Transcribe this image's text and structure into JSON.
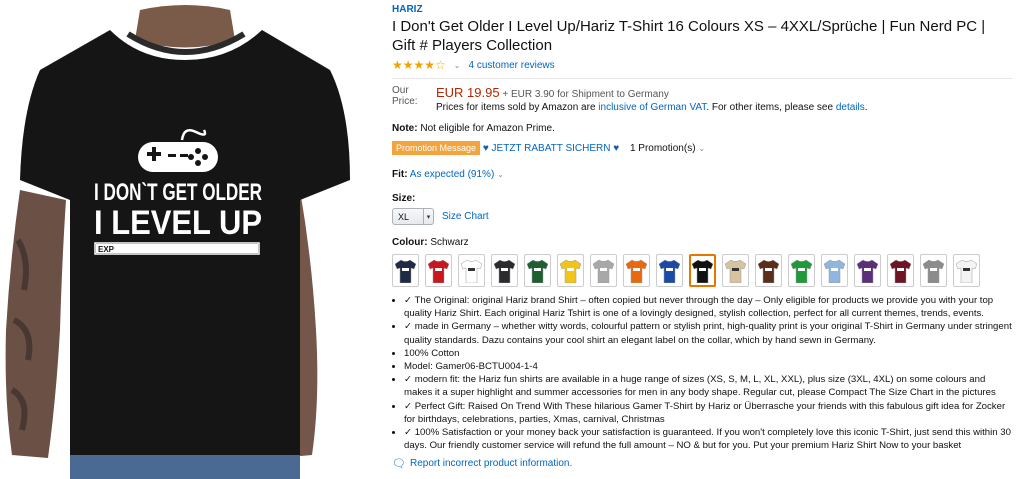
{
  "product_image": {
    "graphic_line1": "I DON`T GET OLDER",
    "graphic_line2": "I LEVEL UP",
    "xp_label": "EXP",
    "xp_progress": 1.0
  },
  "brand": "HARIZ",
  "title": "I Don't Get Older I Level Up/Hariz T-Shirt 16 Colours XS – 4XXL/Sprüche | Fun Nerd PC | Gift # Players Collection",
  "rating": {
    "stars": "★★★★☆",
    "value": 4.5,
    "reviews_label": "4 customer reviews"
  },
  "price": {
    "label": "Our Price:",
    "amount": "EUR 19.95",
    "shipping": "+ EUR 3.90 for Shipment to Germany",
    "vat_pre": "Prices for items sold by Amazon are",
    "vat_link": "inclusive of German VAT",
    "vat_mid": ". For other items, please see",
    "details_link": "details",
    "vat_end": "."
  },
  "note": {
    "label": "Note:",
    "text": "Not eligible for Amazon Prime."
  },
  "promotion": {
    "badge": "Promotion Message",
    "text": "JETZT RABATT SICHERN",
    "count": "1 Promotion(s)"
  },
  "fit": {
    "label": "Fit:",
    "value": "As expected (91%)"
  },
  "size": {
    "label": "Size:",
    "selected": "XL",
    "chart_link": "Size Chart"
  },
  "colour": {
    "label": "Colour:",
    "selected": "Schwarz",
    "swatches": [
      "#1f2a44",
      "#c8171e",
      "#ffffff",
      "#2b2b2f",
      "#1e5e2f",
      "#f2c41a",
      "#a8a8a8",
      "#e86a10",
      "#1a4aa6",
      "#111111",
      "#d8c3a0",
      "#5a2e1a",
      "#1f9a3a",
      "#8fb6e0",
      "#5b2f7a",
      "#6e1424",
      "#8c8c8c",
      "#f4f4f4"
    ],
    "selected_index": 9
  },
  "bullets": [
    "✓ The Original: original Hariz brand Shirt – often copied but never through the day – Only eligible for products we provide you with your top quality Hariz Shirt. Each original Hariz Tshirt is one of a lovingly designed, stylish collection, perfect for all current themes, trends, events.",
    "✓ made in Germany – whether witty words, colourful pattern or stylish print, high-quality print is your original T-Shirt in Germany under stringent quality standards. Dazu contains your cool shirt an elegant label on the collar, which by hand sewn in Germany.",
    "100% Cotton",
    "Model: Gamer06-BCTU004-1-4",
    "✓ modern fit: the Hariz fun shirts are available in a huge range of sizes (XS, S, M, L, XL, XXL), plus size (3XL, 4XL) on some colours and makes it a super highlight and summer accessories for men in any body shape. Regular cut, please Compact The Size Chart in the pictures",
    "✓ Perfect Gift: Raised On Trend With These hilarious Gamer T-Shirt by Hariz or Überrasche your friends with this fabulous gift idea for Zocker for birthdays, celebrations, parties, Xmas, carnival, Christmas",
    "✓ 100% Satisfaction or your money back your satisfaction is guaranteed. If you won't completely love this iconic T-Shirt, just send this within 30 days. Our friendly customer service will refund the full amount – NO & but for you. Put your premium Hariz Shirt Now to your basket"
  ],
  "report_link": "Report incorrect product information."
}
